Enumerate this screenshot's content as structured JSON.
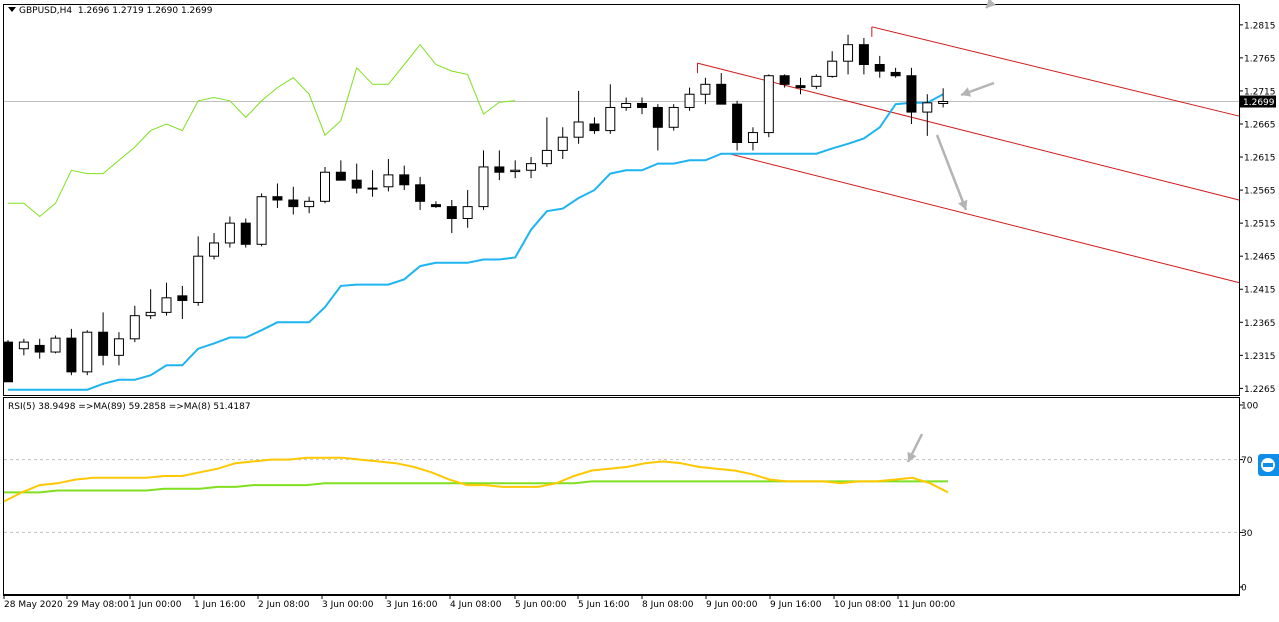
{
  "header": {
    "symbol_label": "GBPUSD,H4",
    "ohlc": "1.2696 1.2719 1.2690 1.2699"
  },
  "rsi_header": "RSI(5) 38.9498  =>MA(89) 59.2858  =>MA(8) 51.4187",
  "price_axis": {
    "labels": [
      "1.2815",
      "1.2765",
      "1.2715",
      "1.2665",
      "1.2615",
      "1.2565",
      "1.2515",
      "1.2465",
      "1.2415",
      "1.2365",
      "1.2315",
      "1.2265"
    ],
    "current_price": "1.2699"
  },
  "rsi_axis": {
    "labels": [
      "100",
      "70",
      "30",
      "0"
    ]
  },
  "time_axis": {
    "labels": [
      "28 May 2020",
      "29 May 08:00",
      "1 Jun 00:00",
      "1 Jun 16:00",
      "2 Jun 08:00",
      "3 Jun 00:00",
      "3 Jun 16:00",
      "4 Jun 08:00",
      "5 Jun 00:00",
      "5 Jun 16:00",
      "8 Jun 08:00",
      "9 Jun 00:00",
      "9 Jun 16:00",
      "10 Jun 08:00",
      "11 Jun 00:00"
    ]
  },
  "colors": {
    "bull_body": "#ffffff",
    "bear_body": "#000000",
    "candle_outline": "#000000",
    "ma_blue": "#1eb4f0",
    "ma_green": "#80e020",
    "channel_red": "#d01818",
    "rsi_yellow": "#ffc800",
    "rsi_ma_green": "#80e020",
    "arrow_gray": "#b4b4b4",
    "price_line": "#c0c0c0"
  },
  "chart_data": [
    {
      "type": "candlestick",
      "title": "GBPUSD,H4",
      "ylim": [
        1.2255,
        1.2845
      ],
      "current_price": 1.2699,
      "candles": [
        {
          "o": 1.2335,
          "h": 1.2338,
          "l": 1.2275,
          "c": 1.2275
        },
        {
          "o": 1.2325,
          "h": 1.234,
          "l": 1.2315,
          "c": 1.2335
        },
        {
          "o": 1.233,
          "h": 1.234,
          "l": 1.231,
          "c": 1.232
        },
        {
          "o": 1.232,
          "h": 1.2345,
          "l": 1.2318,
          "c": 1.2341
        },
        {
          "o": 1.2341,
          "h": 1.2355,
          "l": 1.2285,
          "c": 1.229
        },
        {
          "o": 1.229,
          "h": 1.2353,
          "l": 1.2285,
          "c": 1.235
        },
        {
          "o": 1.235,
          "h": 1.238,
          "l": 1.23,
          "c": 1.2315
        },
        {
          "o": 1.2315,
          "h": 1.235,
          "l": 1.23,
          "c": 1.234
        },
        {
          "o": 1.234,
          "h": 1.239,
          "l": 1.2335,
          "c": 1.2375
        },
        {
          "o": 1.2375,
          "h": 1.2415,
          "l": 1.237,
          "c": 1.238
        },
        {
          "o": 1.238,
          "h": 1.2425,
          "l": 1.2375,
          "c": 1.2402
        },
        {
          "o": 1.2405,
          "h": 1.242,
          "l": 1.237,
          "c": 1.2398
        },
        {
          "o": 1.2395,
          "h": 1.2495,
          "l": 1.239,
          "c": 1.2465
        },
        {
          "o": 1.2465,
          "h": 1.25,
          "l": 1.246,
          "c": 1.2485
        },
        {
          "o": 1.2485,
          "h": 1.2525,
          "l": 1.2478,
          "c": 1.2515
        },
        {
          "o": 1.2515,
          "h": 1.2522,
          "l": 1.2478,
          "c": 1.2483
        },
        {
          "o": 1.2483,
          "h": 1.256,
          "l": 1.248,
          "c": 1.2555
        },
        {
          "o": 1.2555,
          "h": 1.2575,
          "l": 1.2538,
          "c": 1.255
        },
        {
          "o": 1.255,
          "h": 1.257,
          "l": 1.2528,
          "c": 1.254
        },
        {
          "o": 1.254,
          "h": 1.2555,
          "l": 1.253,
          "c": 1.2548
        },
        {
          "o": 1.2548,
          "h": 1.26,
          "l": 1.2545,
          "c": 1.2592
        },
        {
          "o": 1.2592,
          "h": 1.261,
          "l": 1.258,
          "c": 1.258
        },
        {
          "o": 1.258,
          "h": 1.2605,
          "l": 1.256,
          "c": 1.2568
        },
        {
          "o": 1.2568,
          "h": 1.2595,
          "l": 1.2555,
          "c": 1.2568
        },
        {
          "o": 1.257,
          "h": 1.2612,
          "l": 1.2563,
          "c": 1.2588
        },
        {
          "o": 1.2588,
          "h": 1.2602,
          "l": 1.2565,
          "c": 1.2573
        },
        {
          "o": 1.2573,
          "h": 1.2585,
          "l": 1.2535,
          "c": 1.2548
        },
        {
          "o": 1.2543,
          "h": 1.2548,
          "l": 1.2538,
          "c": 1.254
        },
        {
          "o": 1.254,
          "h": 1.255,
          "l": 1.25,
          "c": 1.2522
        },
        {
          "o": 1.2522,
          "h": 1.2565,
          "l": 1.2508,
          "c": 1.254
        },
        {
          "o": 1.254,
          "h": 1.2625,
          "l": 1.2535,
          "c": 1.26
        },
        {
          "o": 1.26,
          "h": 1.2625,
          "l": 1.258,
          "c": 1.2592
        },
        {
          "o": 1.2593,
          "h": 1.261,
          "l": 1.2583,
          "c": 1.2595
        },
        {
          "o": 1.2595,
          "h": 1.2615,
          "l": 1.2583,
          "c": 1.2605
        },
        {
          "o": 1.2605,
          "h": 1.2675,
          "l": 1.26,
          "c": 1.2625
        },
        {
          "o": 1.2625,
          "h": 1.266,
          "l": 1.2612,
          "c": 1.2645
        },
        {
          "o": 1.2645,
          "h": 1.2715,
          "l": 1.2635,
          "c": 1.2668
        },
        {
          "o": 1.2665,
          "h": 1.2675,
          "l": 1.265,
          "c": 1.2655
        },
        {
          "o": 1.2655,
          "h": 1.2725,
          "l": 1.265,
          "c": 1.269
        },
        {
          "o": 1.269,
          "h": 1.2705,
          "l": 1.2685,
          "c": 1.2696
        },
        {
          "o": 1.2696,
          "h": 1.2705,
          "l": 1.268,
          "c": 1.269
        },
        {
          "o": 1.269,
          "h": 1.2695,
          "l": 1.2625,
          "c": 1.266
        },
        {
          "o": 1.266,
          "h": 1.2695,
          "l": 1.2655,
          "c": 1.269
        },
        {
          "o": 1.269,
          "h": 1.272,
          "l": 1.2685,
          "c": 1.271
        },
        {
          "o": 1.271,
          "h": 1.2735,
          "l": 1.2695,
          "c": 1.2725
        },
        {
          "o": 1.2725,
          "h": 1.2742,
          "l": 1.2695,
          "c": 1.2695
        },
        {
          "o": 1.2695,
          "h": 1.27,
          "l": 1.2625,
          "c": 1.2637
        },
        {
          "o": 1.2637,
          "h": 1.266,
          "l": 1.2625,
          "c": 1.2652
        },
        {
          "o": 1.2652,
          "h": 1.274,
          "l": 1.2645,
          "c": 1.2738
        },
        {
          "o": 1.2738,
          "h": 1.274,
          "l": 1.272,
          "c": 1.2725
        },
        {
          "o": 1.2723,
          "h": 1.2735,
          "l": 1.271,
          "c": 1.272
        },
        {
          "o": 1.2722,
          "h": 1.274,
          "l": 1.2718,
          "c": 1.2737
        },
        {
          "o": 1.2737,
          "h": 1.2775,
          "l": 1.2735,
          "c": 1.276
        },
        {
          "o": 1.276,
          "h": 1.28,
          "l": 1.274,
          "c": 1.2785
        },
        {
          "o": 1.2785,
          "h": 1.2795,
          "l": 1.274,
          "c": 1.2755
        },
        {
          "o": 1.2755,
          "h": 1.2768,
          "l": 1.2735,
          "c": 1.2745
        },
        {
          "o": 1.2743,
          "h": 1.275,
          "l": 1.2735,
          "c": 1.2738
        },
        {
          "o": 1.2738,
          "h": 1.275,
          "l": 1.2665,
          "c": 1.2683
        },
        {
          "o": 1.2683,
          "h": 1.271,
          "l": 1.2647,
          "c": 1.2697
        },
        {
          "o": 1.2696,
          "h": 1.2719,
          "l": 1.269,
          "c": 1.2699
        }
      ],
      "ma_blue": [
        1.2263,
        1.2263,
        1.2263,
        1.2263,
        1.2263,
        1.2263,
        1.2272,
        1.2278,
        1.2278,
        1.2285,
        1.23,
        1.23,
        1.2325,
        1.2333,
        1.2342,
        1.2342,
        1.2353,
        1.2365,
        1.2365,
        1.2365,
        1.2388,
        1.242,
        1.2422,
        1.2422,
        1.2422,
        1.243,
        1.245,
        1.2455,
        1.2455,
        1.2455,
        1.246,
        1.246,
        1.2463,
        1.2505,
        1.2533,
        1.2537,
        1.2553,
        1.2565,
        1.259,
        1.2595,
        1.2595,
        1.2605,
        1.2605,
        1.261,
        1.261,
        1.262,
        1.262,
        1.262,
        1.262,
        1.262,
        1.262,
        1.262,
        1.2628,
        1.2635,
        1.2643,
        1.266,
        1.2695,
        1.2697,
        1.2697,
        1.271
      ],
      "ma_green": [
        1.2545,
        1.2545,
        1.2525,
        1.2545,
        1.2595,
        1.259,
        1.259,
        1.261,
        1.263,
        1.2655,
        1.2665,
        1.2655,
        1.27,
        1.2705,
        1.27,
        1.2675,
        1.27,
        1.272,
        1.2735,
        1.271,
        1.2648,
        1.267,
        1.275,
        1.2725,
        1.2725,
        1.2755,
        1.2785,
        1.2755,
        1.2745,
        1.274,
        1.268,
        1.2698,
        1.27
      ],
      "channel": {
        "median_start": {
          "i": 43.5,
          "p": 1.2757
        },
        "median_end_price": 1.255,
        "upper_start": {
          "i": 54.5,
          "p": 1.2812
        },
        "upper_end_price": 1.2677,
        "lower_start": {
          "i": 45.5,
          "p": 1.262
        },
        "lower_end_price": 1.2425
      }
    },
    {
      "type": "line",
      "title": "RSI(5)",
      "ylim": [
        0,
        100
      ],
      "levels": [
        70,
        30
      ],
      "series": [
        {
          "name": "MA(8)",
          "values": [
            47,
            52,
            56,
            57,
            59,
            60,
            60,
            60,
            60,
            61,
            61,
            63,
            65,
            68,
            69,
            70,
            70,
            71,
            71,
            71,
            70,
            69,
            68,
            66,
            63,
            59,
            56,
            56,
            55,
            55,
            55,
            57,
            61,
            64,
            65,
            66,
            68,
            69,
            68,
            66,
            65,
            64,
            62,
            59,
            58,
            58,
            58,
            57,
            58,
            58,
            59,
            60,
            57,
            52
          ]
        },
        {
          "name": "MA(89)",
          "values": [
            52,
            52,
            52,
            53,
            53,
            53,
            53,
            53,
            53,
            54,
            54,
            54,
            55,
            55,
            56,
            56,
            56,
            56,
            57,
            57,
            57,
            57,
            57,
            57,
            57,
            57,
            57,
            57,
            57,
            57,
            57,
            57,
            57,
            58,
            58,
            58,
            58,
            58,
            58,
            58,
            58,
            58,
            58,
            58,
            58,
            58,
            58,
            58,
            58,
            58,
            58,
            58,
            58,
            58
          ]
        }
      ]
    }
  ]
}
